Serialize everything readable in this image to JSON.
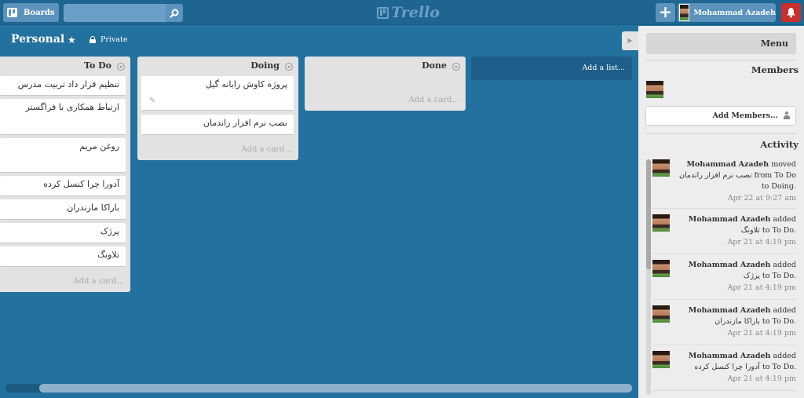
{
  "header": {
    "boards_label": "Boards",
    "search_value": "",
    "logo_text": "Trello",
    "user_name": "Mohammad Azadeh"
  },
  "board": {
    "title": "Personal",
    "visibility": "Private"
  },
  "lists": [
    {
      "title": "To Do",
      "cards": [
        "تنظیم قرار داد تربیت مدرس",
        "ارتباط همکاری با فراگستر",
        "روغن مریم",
        "آدورا چرا کنسل کرده",
        "باراکا مازندران",
        "پرژک",
        "تلاونگ"
      ],
      "add_label": "Add a card..."
    },
    {
      "title": "Doing",
      "cards": [
        "پروژه کاوش رایانه گیل",
        "نصب نرم افزار راندمان"
      ],
      "add_label": "Add a card..."
    },
    {
      "title": "Done",
      "cards": [],
      "add_label": "Add a card..."
    }
  ],
  "add_list_label": "Add a list...",
  "sidebar": {
    "menu_label": "Menu",
    "members_title": "Members",
    "add_members_label": "Add Members...",
    "activity_title": "Activity",
    "activity": [
      {
        "user": "Mohammad Azadeh",
        "text": " moved نصب نرم افزار راندمان from To Do to Doing.",
        "time": "Apr 22 at 9:27 am"
      },
      {
        "user": "Mohammad Azadeh",
        "text": " added تلاونگ to To Do.",
        "time": "Apr 21 at 4:19 pm"
      },
      {
        "user": "Mohammad Azadeh",
        "text": " added پرژک to To Do.",
        "time": "Apr 21 at 4:19 pm"
      },
      {
        "user": "Mohammad Azadeh",
        "text": " added باراکا مازندران to To Do.",
        "time": "Apr 21 at 4:19 pm"
      },
      {
        "user": "Mohammad Azadeh",
        "text": " added آدورا چرا کنسل کرده to To Do.",
        "time": "Apr 21 at 4:19 pm"
      }
    ]
  },
  "colors": {
    "board_bg": "#23719f",
    "header_bg": "#1f6592",
    "button_bg": "#5b93bd",
    "notification": "#c9302c",
    "list_bg": "#e2e2e2",
    "sidebar_bg": "#ededed"
  },
  "icons": [
    "boards-icon",
    "search-icon",
    "plus-icon",
    "avatar",
    "bell-icon",
    "star-icon",
    "lock-icon",
    "list-menu-icon",
    "pencil-icon",
    "person-icon"
  ]
}
